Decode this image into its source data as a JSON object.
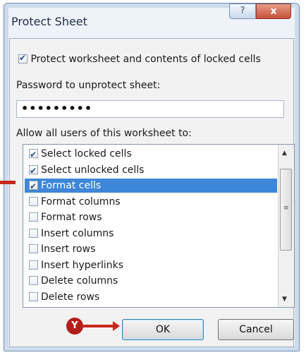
{
  "window": {
    "title": "Protect Sheet",
    "help_glyph": "?",
    "close_glyph": "x"
  },
  "protect": {
    "checked": true,
    "label": "Protect worksheet and contents of locked cells"
  },
  "password": {
    "label": "Password to unprotect sheet:",
    "value": "•••••••••"
  },
  "permissions": {
    "label": "Allow all users of this worksheet to:",
    "items": [
      {
        "label": "Select locked cells",
        "checked": true,
        "selected": false
      },
      {
        "label": "Select unlocked cells",
        "checked": true,
        "selected": false
      },
      {
        "label": "Format cells",
        "checked": true,
        "selected": true
      },
      {
        "label": "Format columns",
        "checked": false,
        "selected": false
      },
      {
        "label": "Format rows",
        "checked": false,
        "selected": false
      },
      {
        "label": "Insert columns",
        "checked": false,
        "selected": false
      },
      {
        "label": "Insert rows",
        "checked": false,
        "selected": false
      },
      {
        "label": "Insert hyperlinks",
        "checked": false,
        "selected": false
      },
      {
        "label": "Delete columns",
        "checked": false,
        "selected": false
      },
      {
        "label": "Delete rows",
        "checked": false,
        "selected": false
      }
    ]
  },
  "buttons": {
    "ok": "OK",
    "cancel": "Cancel"
  },
  "annotation": {
    "step": "Y"
  },
  "colors": {
    "selection": "#3d86d8",
    "callout": "#b31e1a"
  }
}
